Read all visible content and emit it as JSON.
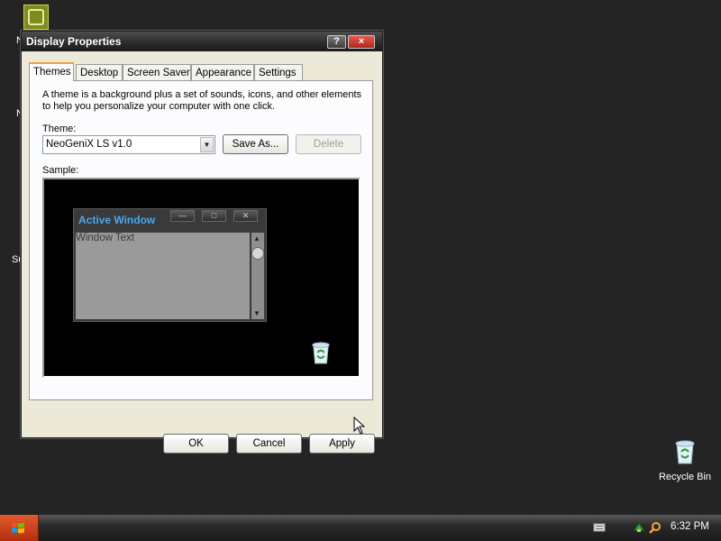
{
  "desktop": {
    "fragments": [
      "N",
      "N",
      "Su"
    ],
    "recycle_bin_label": "Recycle Bin"
  },
  "window": {
    "title": "Display Properties",
    "help_button": "?",
    "close_button": "×",
    "tabs": [
      "Themes",
      "Desktop",
      "Screen Saver",
      "Appearance",
      "Settings"
    ],
    "active_tab": "Themes",
    "description": "A theme is a background plus a set of sounds, icons, and other elements to help you personalize your computer with one click.",
    "theme_label": "Theme:",
    "theme_value": "NeoGeniX LS v1.0",
    "save_as_label": "Save As...",
    "delete_label": "Delete",
    "sample_label": "Sample:",
    "sample_window": {
      "title": "Active Window",
      "text": "Window Text",
      "min": "—",
      "max": "□",
      "close": "✕"
    },
    "ok_label": "OK",
    "cancel_label": "Cancel",
    "apply_label": "Apply"
  },
  "taskbar": {
    "clock": "6:32 PM",
    "tray_icons": [
      "keyboard-icon",
      "network-icon",
      "search-icon"
    ]
  },
  "colors": {
    "desktop_bg": "#242424",
    "title_accent": "#4aa8f0",
    "active_tab_accent": "#f0a43a",
    "start_button": "#d8471e"
  }
}
